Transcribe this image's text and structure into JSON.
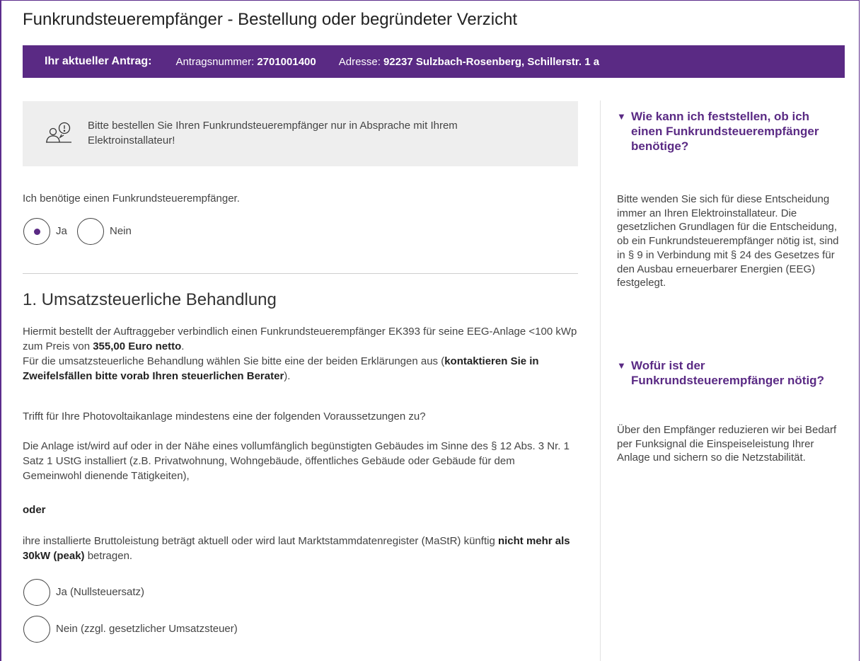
{
  "page": {
    "title": "Funkrundsteuerempfänger - Bestellung oder begründeter Verzicht"
  },
  "banner": {
    "label": "Ihr aktueller Antrag:",
    "number_label": "Antragsnummer:",
    "number_value": "2701001400",
    "address_label": "Adresse:",
    "address_value": "92237 Sulzbach-Rosenberg, Schillerstr. 1 a",
    "background": "#5a2a84"
  },
  "info": {
    "icon": "person-idea-icon",
    "text": "Bitte bestellen Sie Ihren Funkrundsteuerempfänger nur in Absprache mit Ihrem Elektroinstallateur!"
  },
  "question1": {
    "text": "Ich benötige einen Funkrundsteuerempfänger.",
    "options": [
      {
        "label": "Ja",
        "checked": true
      },
      {
        "label": "Nein",
        "checked": false
      }
    ]
  },
  "section1": {
    "heading": "1. Umsatzsteuerliche Behandlung",
    "p1_a": "Hiermit bestellt der Auftraggeber verbindlich einen Funkrundsteuerempfänger EK393 für seine EEG-Anlage <100 kWp zum Preis von ",
    "p1_price": "355,00 Euro netto",
    "p1_b": ".",
    "p2_a": "Für die umsatzsteuerliche Behandlung wählen Sie bitte eine der beiden Erklärungen aus (",
    "p2_bold": "kontaktieren Sie in Zweifelsfällen bitte vorab Ihren steuerlichen Berater",
    "p2_b": ").",
    "question": "Trifft für Ihre Photovoltaikanlage mindestens eine der folgenden Voraussetzungen zu?",
    "condition1": "Die Anlage ist/wird auf oder in der Nähe eines vollumfänglich begünstigten Gebäudes im Sinne des § 12 Abs. 3 Nr. 1 Satz 1 UStG installiert (z.B. Privatwohnung, Wohngebäude, öffentliches Gebäude oder Gebäude für dem Gemeinwohl dienende Tätigkeiten),",
    "or": "oder",
    "condition2_a": "ihre installierte Bruttoleistung beträgt aktuell oder wird laut Marktstammdatenregister (MaStR) künftig ",
    "condition2_bold": "nicht mehr als 30kW (peak)",
    "condition2_b": " betragen.",
    "options": [
      {
        "label": "Ja (Nullsteuersatz)",
        "checked": false
      },
      {
        "label": "Nein (zzgl. gesetzlicher Umsatzsteuer)",
        "checked": false
      }
    ]
  },
  "sidebar": {
    "items": [
      {
        "title": "Wie kann ich feststellen, ob ich einen Funkrundsteuerempfänger benötige?",
        "text": "Bitte wenden Sie sich für diese Entscheidung immer an Ihren Elektroinstallateur. Die gesetzlichen Grundlagen für die Entscheidung, ob ein Funkrundsteuerempfänger nötig ist, sind in § 9 in Verbindung mit § 24 des Gesetzes für den Ausbau erneuerbarer Energien (EEG) festgelegt."
      },
      {
        "title": "Wofür ist der Funkrundsteuerempfänger nötig?",
        "text": "Über den Empfänger reduzieren wir bei Bedarf per Funksignal die Einspeiseleistung Ihrer Anlage und sichern so die Netzstabilität."
      }
    ],
    "expand_icon": "triangle-down-icon",
    "accent": "#5a2a84"
  }
}
